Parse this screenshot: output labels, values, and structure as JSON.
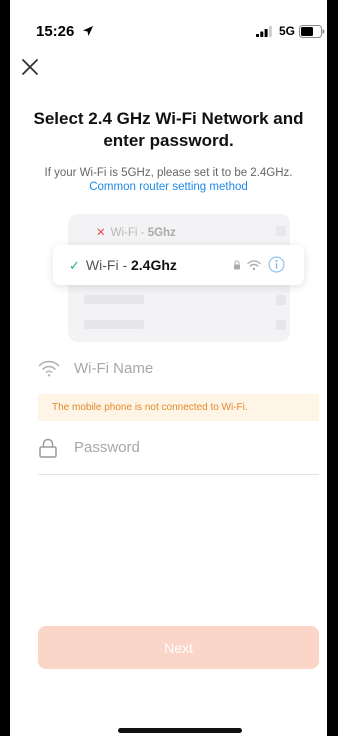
{
  "status_bar": {
    "time": "15:26",
    "network": "5G"
  },
  "header": {
    "close_icon": "close-icon"
  },
  "title": "Select 2.4 GHz Wi-Fi Network and enter password.",
  "subtitle": "If your Wi-Fi is 5GHz, please set it to be 2.4GHz.",
  "link": "Common router setting method",
  "illustration": {
    "row_5ghz": {
      "prefix": "Wi-Fi - ",
      "band": "5Ghz",
      "status_icon": "x-icon"
    },
    "row_24ghz": {
      "prefix": "Wi-Fi - ",
      "band": "2.4Ghz",
      "status_icon": "check-icon"
    }
  },
  "form": {
    "wifi_placeholder": "Wi-Fi Name",
    "wifi_value": "",
    "warning": "The mobile phone is not connected to Wi-Fi.",
    "password_placeholder": "Password",
    "password_value": ""
  },
  "next_label": "Next",
  "colors": {
    "accent_link": "#1e8ae6",
    "warning_text": "#e08a2a",
    "warning_bg": "#fff5e6",
    "button_disabled": "#fbd6c8",
    "check_green": "#2cb56e",
    "x_red": "#e05050"
  }
}
